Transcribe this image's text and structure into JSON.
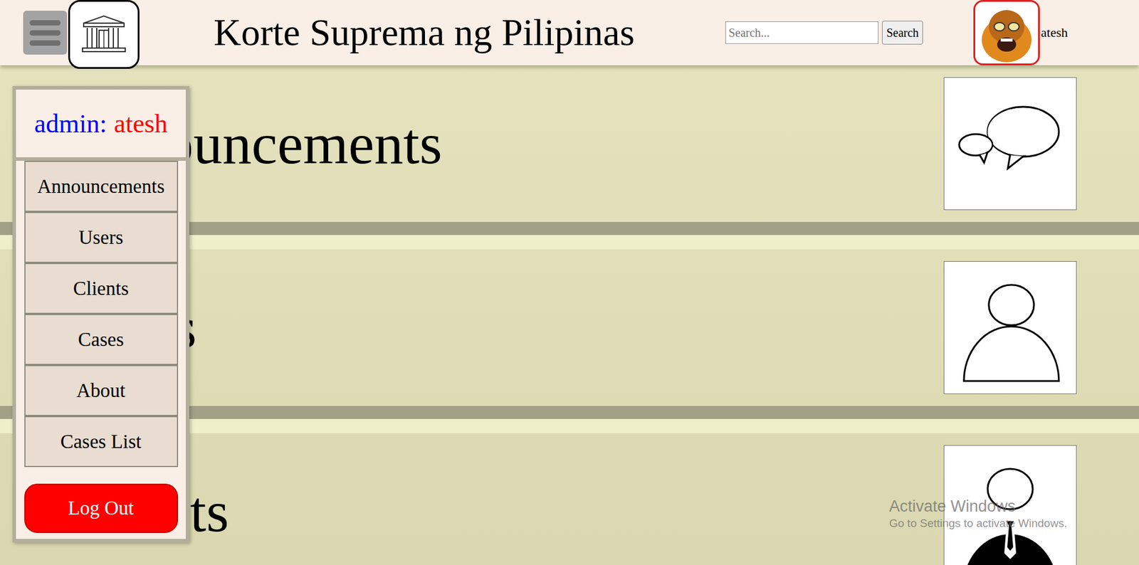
{
  "header": {
    "title": "Korte Suprema ng Pilipinas",
    "search": {
      "placeholder": "Search...",
      "button": "Search"
    },
    "user": {
      "name": "atesh"
    }
  },
  "sidebar": {
    "role": "admin:",
    "user": "atesh",
    "items": [
      "Announcements",
      "Users",
      "Clients",
      "Cases",
      "About",
      "Cases List"
    ],
    "logout": "Log Out"
  },
  "sections": [
    {
      "title": "Announcements",
      "kind": "announcements"
    },
    {
      "title": "Users",
      "kind": "users"
    },
    {
      "title": "Clients",
      "kind": "clients"
    }
  ],
  "watermark": {
    "title": "Activate Windows",
    "subtitle": "Go to Settings to activate Windows."
  }
}
